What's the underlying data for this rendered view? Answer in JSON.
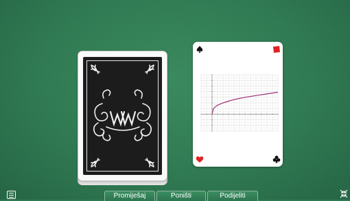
{
  "toolbar": {
    "shuffle_label": "Promiješaj",
    "undo_label": "Poništi",
    "deal_label": "Podijeliti"
  },
  "icons": {
    "menu": "hamburger-menu-icon",
    "resize": "shrink-arrows-icon",
    "top_left_suit": "spade-icon",
    "top_right_suit": "diamond-icon",
    "bottom_left_suit": "heart-icon",
    "bottom_right_suit": "club-icon"
  },
  "colors": {
    "felt": "#2f7a52",
    "suit_red": "#e02424",
    "suit_black": "#111111",
    "curve": "#a0307a"
  },
  "card_back": {
    "monogram": "ww"
  },
  "face_card": {
    "chart_data": {
      "type": "line",
      "title": "",
      "xlabel": "",
      "ylabel": "",
      "xlim": [
        -2,
        12
      ],
      "ylim": [
        -3,
        7
      ],
      "grid": true,
      "series": [
        {
          "x": [
            0,
            0.25,
            1,
            2,
            3,
            4,
            6,
            8,
            10,
            12
          ],
          "y": [
            0,
            1.0,
            1.6,
            2.0,
            2.3,
            2.6,
            3.0,
            3.3,
            3.6,
            3.9
          ]
        }
      ]
    }
  }
}
